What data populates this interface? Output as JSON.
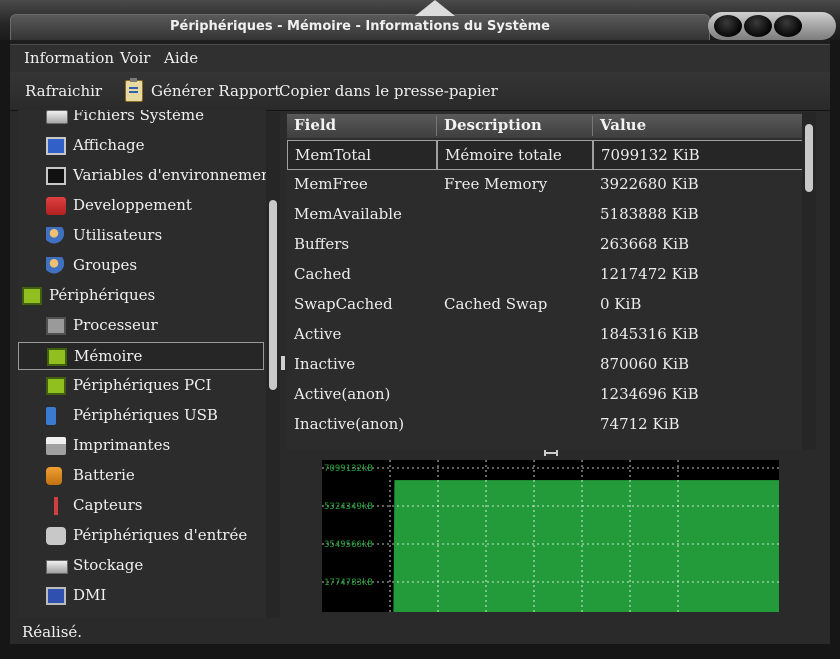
{
  "window": {
    "title": "Périphériques - Mémoire - Informations du Système"
  },
  "menu": {
    "items": [
      "Information",
      "Voir",
      "Aide"
    ]
  },
  "toolbar": {
    "refresh": "Rafraichir",
    "report": "Générer Rapport",
    "copy": "Copier dans le presse-papier"
  },
  "sidebar": {
    "items": [
      {
        "label": "Fichiers Système",
        "icon": "drive-icon",
        "level": 1
      },
      {
        "label": "Affichage",
        "icon": "monitor-icon",
        "level": 1
      },
      {
        "label": "Variables d'environnement",
        "icon": "terminal-icon",
        "level": 1
      },
      {
        "label": "Developpement",
        "icon": "development-icon",
        "level": 1
      },
      {
        "label": "Utilisateurs",
        "icon": "users-icon",
        "level": 1
      },
      {
        "label": "Groupes",
        "icon": "groups-icon",
        "level": 1
      },
      {
        "label": "Périphériques",
        "icon": "devices-icon",
        "level": 0
      },
      {
        "label": "Processeur",
        "icon": "processor-icon",
        "level": 1
      },
      {
        "label": "Mémoire",
        "icon": "memory-icon",
        "level": 1,
        "selected": true
      },
      {
        "label": "Périphériques PCI",
        "icon": "pci-icon",
        "level": 1
      },
      {
        "label": "Périphériques USB",
        "icon": "usb-icon",
        "level": 1
      },
      {
        "label": "Imprimantes",
        "icon": "printer-icon",
        "level": 1
      },
      {
        "label": "Batterie",
        "icon": "battery-icon",
        "level": 1
      },
      {
        "label": "Capteurs",
        "icon": "sensor-icon",
        "level": 1
      },
      {
        "label": "Périphériques d'entrée",
        "icon": "input-devices-icon",
        "level": 1
      },
      {
        "label": "Stockage",
        "icon": "storage-icon",
        "level": 1
      },
      {
        "label": "DMI",
        "icon": "dmi-icon",
        "level": 1
      }
    ]
  },
  "table": {
    "columns": [
      "Field",
      "Description",
      "Value"
    ],
    "rows": [
      [
        "MemTotal",
        "Mémoire totale",
        "7099132 KiB"
      ],
      [
        "MemFree",
        "Free Memory",
        "3922680 KiB"
      ],
      [
        "MemAvailable",
        "",
        "5183888 KiB"
      ],
      [
        "Buffers",
        "",
        "263668 KiB"
      ],
      [
        "Cached",
        "",
        "1217472 KiB"
      ],
      [
        "SwapCached",
        "Cached Swap",
        "0 KiB"
      ],
      [
        "Active",
        "",
        "1845316 KiB"
      ],
      [
        "Inactive",
        "",
        "870060 KiB"
      ],
      [
        "Active(anon)",
        "",
        "1234696 KiB"
      ],
      [
        "Inactive(anon)",
        "",
        "74712 KiB"
      ]
    ]
  },
  "chart_data": {
    "type": "area",
    "y_labels": [
      "7099132kB",
      "5324349kB",
      "3549566kB",
      "1774783kB"
    ],
    "ylim": [
      0,
      7099132
    ],
    "values": [
      0,
      0,
      0,
      0,
      0,
      0,
      0,
      0,
      0,
      0,
      0,
      0,
      0,
      0,
      0,
      0,
      0,
      0,
      0,
      0,
      0,
      0,
      0,
      0,
      0,
      0,
      0,
      0,
      0,
      0,
      0,
      0,
      0,
      0,
      0,
      0,
      0,
      0,
      0,
      0,
      0,
      0,
      0,
      0,
      0,
      0,
      0,
      0,
      0,
      0,
      0,
      0,
      0,
      0,
      0,
      0,
      0,
      0,
      0,
      0,
      0,
      0,
      0,
      0,
      0,
      0,
      0,
      0,
      0,
      1,
      2,
      6500000,
      6500000,
      6500000,
      6500000,
      6500000,
      6500000,
      6500000,
      6500000,
      6500000,
      6500000,
      6500000,
      6500000,
      6500000,
      6500000,
      6500000,
      6500000,
      6500000,
      6500000,
      6500000,
      6500000,
      6500000,
      6500000,
      6500000,
      6500000,
      6500000,
      6500000,
      6500000,
      6500000,
      6500000,
      6500000,
      6500000,
      6500000,
      6500000,
      6500000,
      6500000,
      6500000,
      6500000,
      6500000,
      6500000,
      6500000,
      6500000,
      6500000,
      6500000,
      6500000,
      6500000,
      6500000,
      6500000,
      6500000,
      6500000,
      6500000,
      6500000,
      6500000,
      6500000,
      6500000,
      6500000,
      6500000,
      6500000,
      6500000,
      6500000,
      6500000,
      6500000,
      6500000,
      6500000,
      6500000,
      6500000,
      6500000,
      6500000,
      6500000,
      6500000,
      6500000,
      6500000,
      6500000,
      6500000,
      6500000,
      6500000,
      6500000,
      6500000,
      6500000,
      6500000,
      6500000,
      6500000,
      6500000,
      6500000,
      6500000,
      6500000,
      6500000,
      6500000,
      6500000,
      6500000,
      6500000,
      6500000,
      6500000,
      6500000,
      6500000,
      6500000,
      6500000,
      6500000,
      6500000,
      6500000,
      6500000,
      6500000,
      6500000,
      6500000,
      6500000,
      6500000,
      6500000,
      6500000,
      6500000,
      6500000,
      6500000,
      6500000,
      6500000,
      6500000,
      6500000,
      6500000,
      6500000,
      6500000,
      6500000,
      6500000,
      6500000,
      6500000,
      6500000,
      6500000,
      6500000,
      6500000,
      6500000,
      6500000,
      6500000,
      6500000,
      6500000,
      6500000,
      6500000,
      6500000,
      6500000,
      6500000,
      6500000,
      6500000,
      6500000,
      6500000,
      6500000,
      6500000,
      6500000,
      6500000,
      6500000,
      6500000,
      6500000,
      6500000,
      6500000,
      6500000,
      6500000,
      6500000,
      6500000,
      6500000,
      6500000,
      6500000,
      6500000,
      6500000,
      6500000,
      6500000,
      6500000,
      6500000,
      6500000,
      6500000,
      6500000,
      6500000,
      6500000,
      6500000,
      6500000,
      6500000,
      6500000,
      6500000,
      6500000,
      6500000,
      6500000,
      6500000,
      6500000,
      6500000,
      6500000,
      6500000,
      6500000,
      6500000,
      6500000,
      6500000,
      6500000,
      6500000,
      6500000,
      6500000,
      6500000,
      6500000,
      6500000,
      6500000,
      6500000,
      6500000,
      6500000,
      6500000,
      6500000,
      6500000,
      6500000,
      6500000,
      6500000,
      6500000,
      6500000,
      6500000,
      6500000,
      6500000,
      6500000,
      6500000,
      6500000,
      6500000,
      6500000,
      6500000,
      6500000,
      6500000,
      6500000,
      6500000,
      6500000,
      6500000,
      6500000,
      6500000,
      6500000,
      6500000,
      6500000,
      6500000,
      6500000,
      6500000,
      6500000,
      6500000,
      6500000,
      6500000,
      6500000,
      6500000,
      6500000,
      6500000,
      6500000,
      6500000,
      6500000,
      6500000,
      6500000,
      6500000,
      6500000,
      6500000,
      6500000,
      6500000,
      6500000,
      6500000,
      6500000,
      6500000,
      6500000,
      6500000,
      6500000,
      6500000,
      6500000,
      6500000,
      6500000,
      6500000,
      6500000,
      6500000,
      6500000,
      6500000,
      6500000,
      6500000,
      6500000,
      6500000,
      6500000,
      6500000,
      6500000,
      6500000,
      6500000,
      6500000,
      6500000,
      6500000,
      6500000,
      6500000,
      6500000,
      6500000,
      6500000,
      6500000,
      6500000,
      6500000,
      6500000,
      6500000,
      6500000,
      6500000,
      6500000,
      6500000,
      6500000,
      6500000,
      6500000,
      6500000,
      6500000,
      6500000,
      6500000,
      6500000,
      6500000,
      6500000,
      6500000,
      6500000,
      6500000,
      6500000,
      6500000,
      6500000,
      6500000,
      6500000,
      6500000,
      6500000,
      6500000,
      6500000,
      6500000,
      6500000,
      6500000,
      6500000,
      6500000,
      6500000,
      6500000,
      6500000,
      6500000,
      6500000,
      6500000,
      6500000,
      6500000,
      6500000,
      6500000,
      6500000,
      6500000,
      6500000,
      6500000,
      6500000,
      6500000,
      6500000,
      6500000,
      6500000,
      6500000,
      6500000,
      6500000,
      6500000,
      6500000,
      6500000,
      6500000,
      6500000,
      6500000,
      6500000,
      6500000,
      6500000,
      6500000,
      6500000,
      6500000,
      6500000,
      6500000,
      6500000,
      6500000,
      6500000,
      6500000,
      6500000,
      6500000,
      6500000,
      6500000,
      6500000,
      6500000,
      6500000,
      6500000,
      6500000,
      6500000,
      6500000,
      6500000,
      6500000,
      6500000,
      6500000,
      6500000,
      6500000,
      6500000,
      6500000,
      6500000,
      6500000,
      6500000,
      6500000,
      6500000,
      6500000,
      6500000
    ],
    "grid": true,
    "colors": {
      "fill": "#239b3a",
      "background": "#000000",
      "grid": "#ffffff",
      "label": "#23a23a"
    }
  },
  "status": {
    "text": "Réalisé."
  }
}
